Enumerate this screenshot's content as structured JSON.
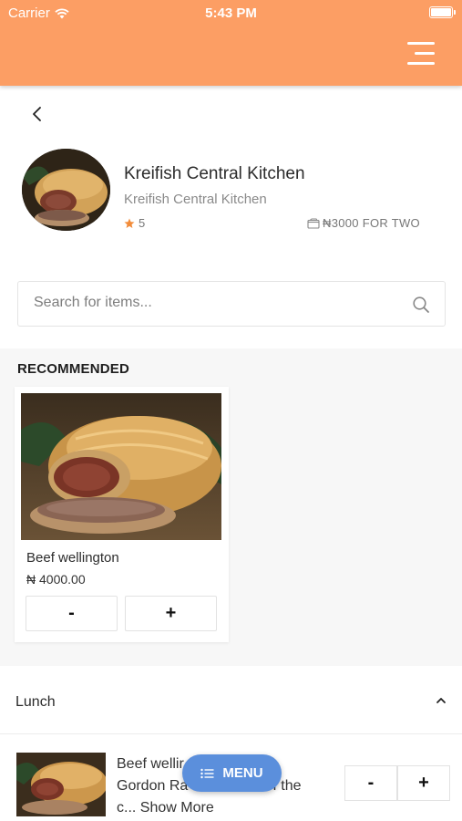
{
  "status_bar": {
    "carrier": "Carrier",
    "time": "5:43 PM"
  },
  "nav": {
    "menu_icon": "menu-icon",
    "back_icon": "chevron-left-icon"
  },
  "restaurant": {
    "title": "Kreifish Central Kitchen",
    "subtitle": "Kreifish Central Kitchen",
    "rating": "5",
    "price_for_two": "₦3000 FOR TWO"
  },
  "search": {
    "placeholder": "Search for items..."
  },
  "recommended": {
    "heading": "RECOMMENDED",
    "items": [
      {
        "name": "Beef wellington",
        "price": "₦ 4000.00",
        "minus": "-",
        "plus": "+"
      }
    ]
  },
  "category": {
    "title": "Lunch",
    "items": [
      {
        "description_line1": "Beef wellir",
        "description_line2": "Gordon Ra",
        "description_line2_tail": "on of the",
        "description_line3": "c...",
        "show_more": "Show More",
        "minus": "-",
        "plus": "+"
      }
    ]
  },
  "fab": {
    "label": "MENU"
  },
  "colors": {
    "header": "#fc9e64",
    "accent": "#5b8fdc",
    "star": "#f28c3a"
  }
}
